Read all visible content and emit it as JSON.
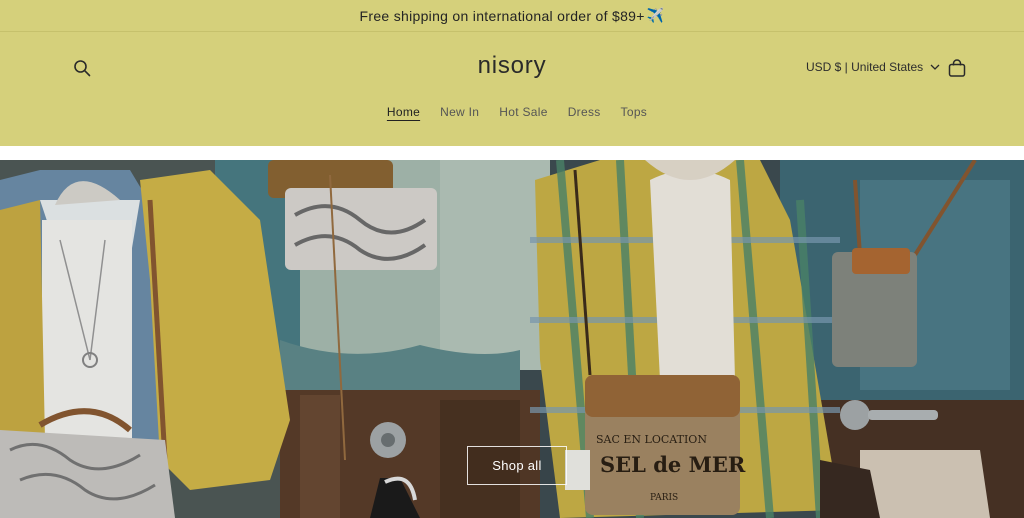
{
  "announcement": {
    "text": "Free shipping on international order of $89+",
    "icon": "airplane-icon",
    "icon_glyph": "✈️"
  },
  "header": {
    "logo": "nisory",
    "currency": "USD $ | United States",
    "search_icon": "search-icon",
    "cart_icon": "cart-icon"
  },
  "nav": {
    "items": [
      {
        "label": "Home",
        "active": true
      },
      {
        "label": "New In",
        "active": false
      },
      {
        "label": "Hot Sale",
        "active": false
      },
      {
        "label": "Dress",
        "active": false
      },
      {
        "label": "Tops",
        "active": false
      }
    ]
  },
  "hero": {
    "button_label": "Shop all",
    "bag_print_line1": "SAC EN LOCATION",
    "bag_print_line2": "SEL de MER",
    "bag_print_line3": "PARIS"
  },
  "colors": {
    "header_bg": "#d5d07b",
    "text": "#2a2a2a"
  }
}
